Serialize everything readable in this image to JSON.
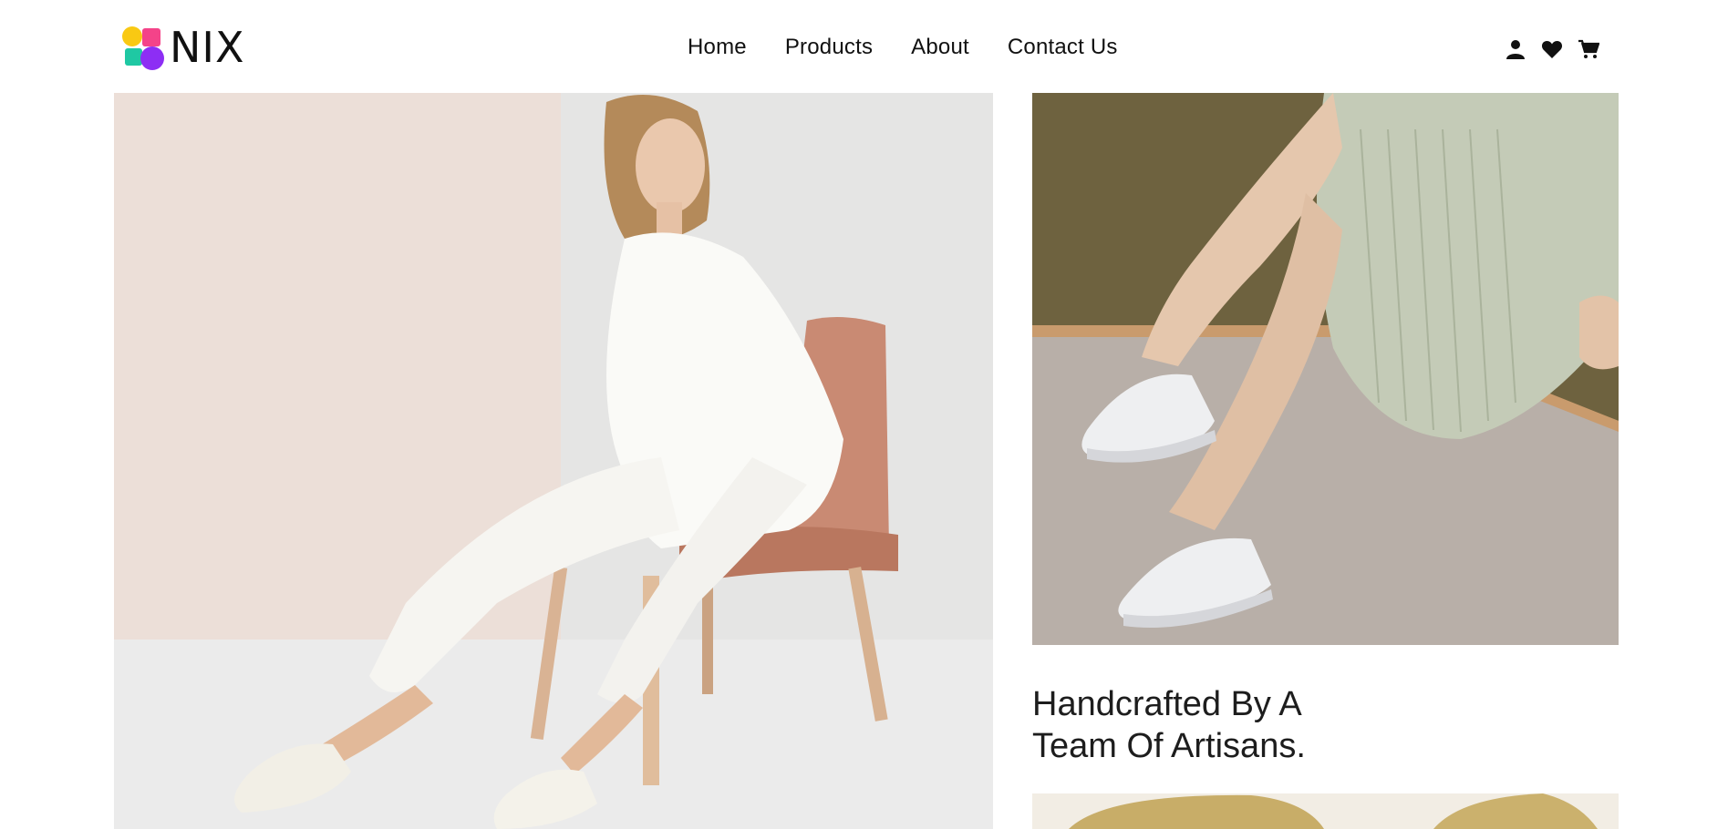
{
  "brand": {
    "name": "NIX"
  },
  "nav": {
    "items": [
      {
        "label": "Home"
      },
      {
        "label": "Products"
      },
      {
        "label": "About"
      },
      {
        "label": "Contact Us"
      }
    ]
  },
  "header_icons": [
    "user-icon",
    "heart-icon",
    "cart-icon"
  ],
  "feature": {
    "tagline_line1": "Handcrafted By A",
    "tagline_line2": "Team Of Artisans."
  },
  "colors": {
    "logo_yellow": "#f9c913",
    "logo_pink": "#f44389",
    "logo_teal": "#1fc8a3",
    "logo_purple": "#8d2ef4",
    "text": "#111111"
  }
}
